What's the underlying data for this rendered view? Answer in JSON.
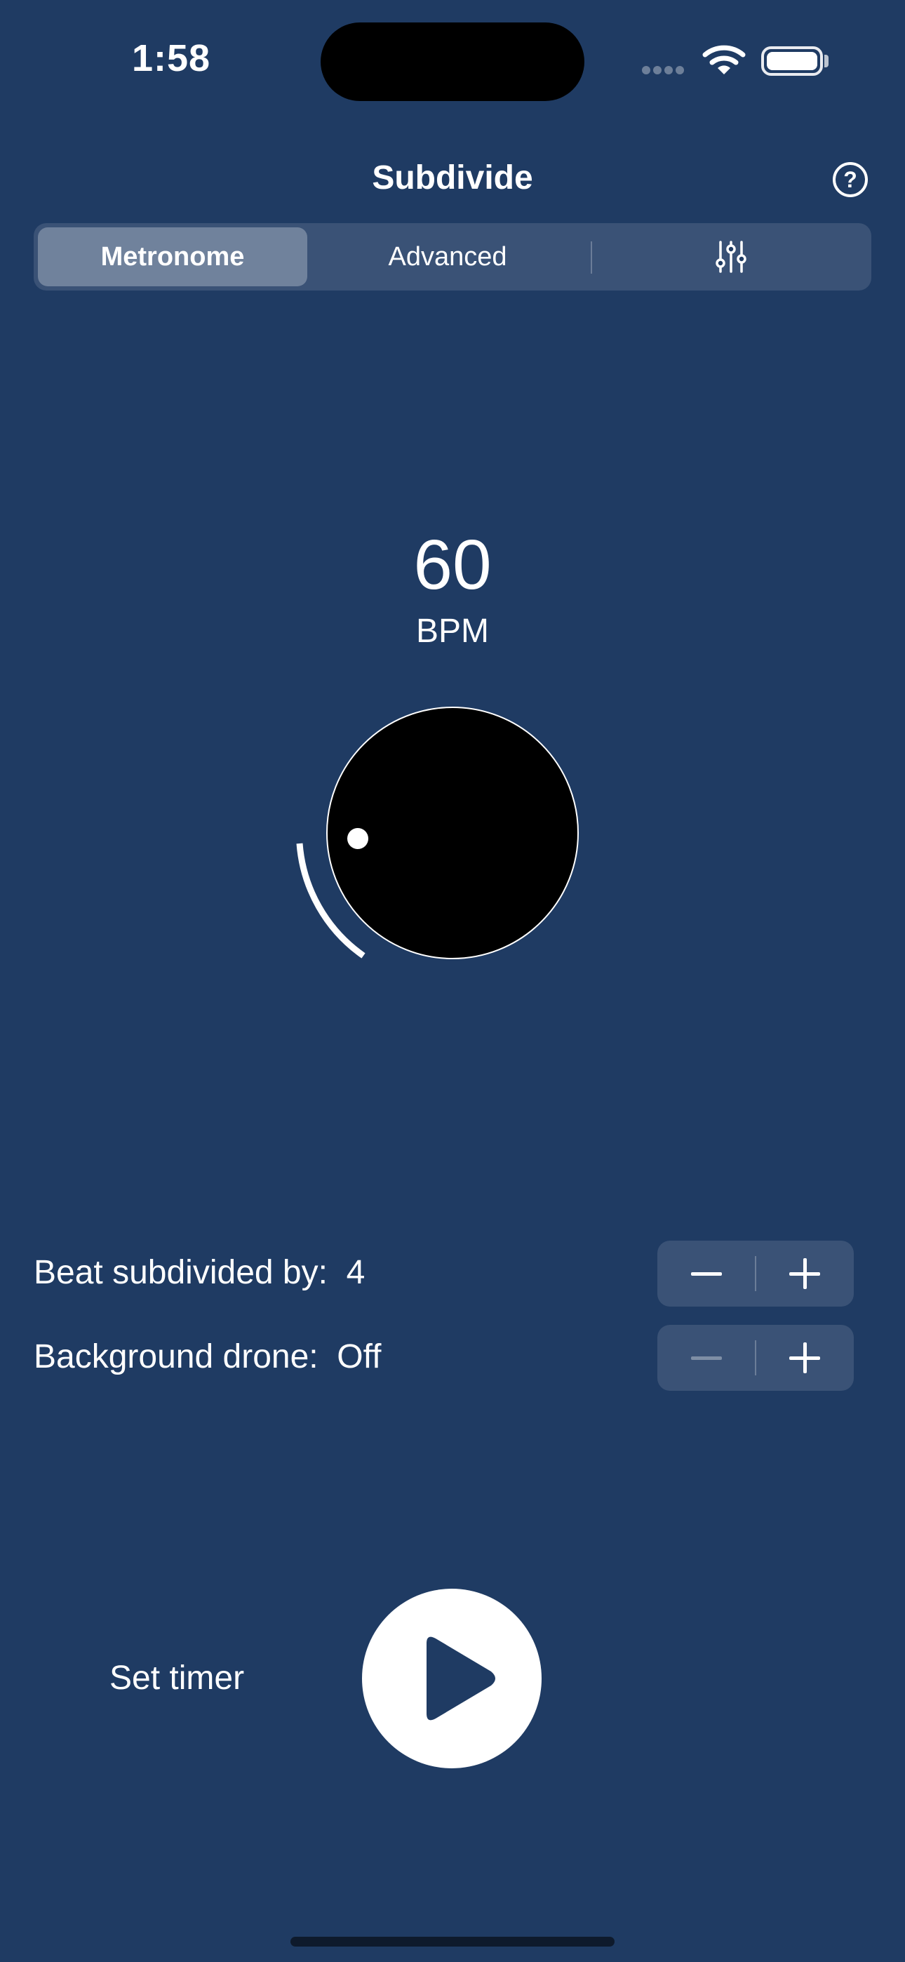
{
  "status_bar": {
    "time": "1:58"
  },
  "header": {
    "title": "Subdivide",
    "help_icon": "?"
  },
  "tabs": {
    "items": [
      {
        "label": "Metronome",
        "selected": true
      },
      {
        "label": "Advanced",
        "selected": false
      },
      {
        "icon": "sliders-icon",
        "selected": false
      }
    ]
  },
  "tempo": {
    "value": "60",
    "unit": "BPM"
  },
  "subdivision": {
    "label": "Beat subdivided by:",
    "value": "4"
  },
  "drone": {
    "label": "Background drone:",
    "value": "Off"
  },
  "timer": {
    "label": "Set timer"
  },
  "colors": {
    "background": "#1f3b63",
    "dial": "#000000",
    "accent": "#ffffff"
  }
}
